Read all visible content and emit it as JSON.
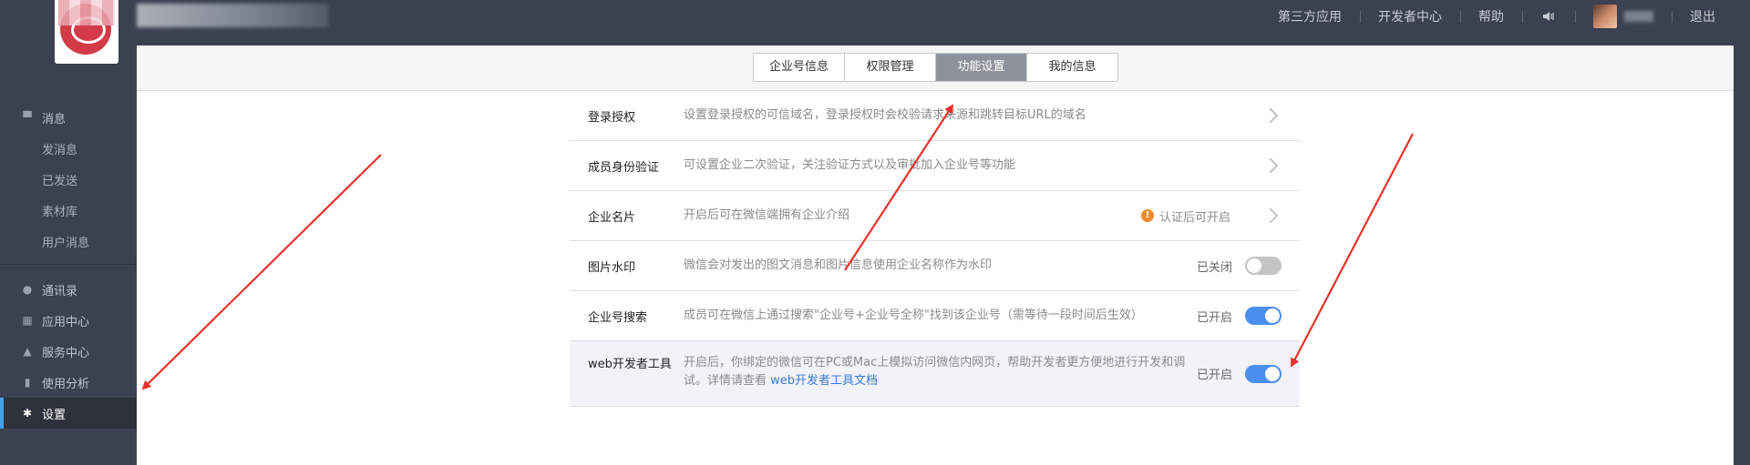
{
  "topnav": {
    "items": [
      "第三方应用",
      "开发者中心",
      "帮助"
    ],
    "logout": "退出"
  },
  "sidebar": {
    "groups": [
      {
        "items": [
          {
            "label": "消息",
            "icon": "message-icon",
            "sub": false
          },
          {
            "label": "发消息",
            "sub": true
          },
          {
            "label": "已发送",
            "sub": true
          },
          {
            "label": "素材库",
            "sub": true
          },
          {
            "label": "用户消息",
            "sub": true
          }
        ]
      },
      {
        "items": [
          {
            "label": "通讯录",
            "icon": "contacts-icon"
          },
          {
            "label": "应用中心",
            "icon": "apps-icon"
          },
          {
            "label": "服务中心",
            "icon": "service-icon"
          },
          {
            "label": "使用分析",
            "icon": "analytics-icon"
          },
          {
            "label": "设置",
            "icon": "gear-icon",
            "active": true
          }
        ]
      }
    ]
  },
  "tabs": [
    {
      "label": "企业号信息",
      "active": false
    },
    {
      "label": "权限管理",
      "active": false
    },
    {
      "label": "功能设置",
      "active": true
    },
    {
      "label": "我的信息",
      "active": false
    }
  ],
  "settings": [
    {
      "name": "登录授权",
      "desc": "设置登录授权的可信域名，登录授权时会校验请求来源和跳转目标URL的域名",
      "control": "chevron"
    },
    {
      "name": "成员身份验证",
      "desc": "可设置企业二次验证，关注验证方式以及审批加入企业号等功能",
      "control": "chevron"
    },
    {
      "name": "企业名片",
      "desc": "开启后可在微信端拥有企业介绍",
      "control": "chevron",
      "warning": "认证后可开启"
    },
    {
      "name": "图片水印",
      "desc": "微信会对发出的图文消息和图片信息使用企业名称作为水印",
      "control": "toggle",
      "state": "已关闭",
      "on": false
    },
    {
      "name": "企业号搜索",
      "desc": "成员可在微信上通过搜索\"企业号+企业号全称\"找到该企业号（需等待一段时间后生效）",
      "control": "toggle",
      "state": "已开启",
      "on": true
    },
    {
      "name": "web开发者工具",
      "desc": "开启后，你绑定的微信可在PC或Mac上模拟访问微信内网页，帮助开发者更方便地进行开发和调试。详情请查看 ",
      "link": "web开发者工具文档",
      "control": "toggle",
      "state": "已开启",
      "on": true,
      "highlight": true
    }
  ],
  "colors": {
    "sidebar_bg": "#3b4150",
    "accent": "#44a0ec",
    "toggle_on": "#4a8ff0",
    "arrow": "#e8322b"
  }
}
